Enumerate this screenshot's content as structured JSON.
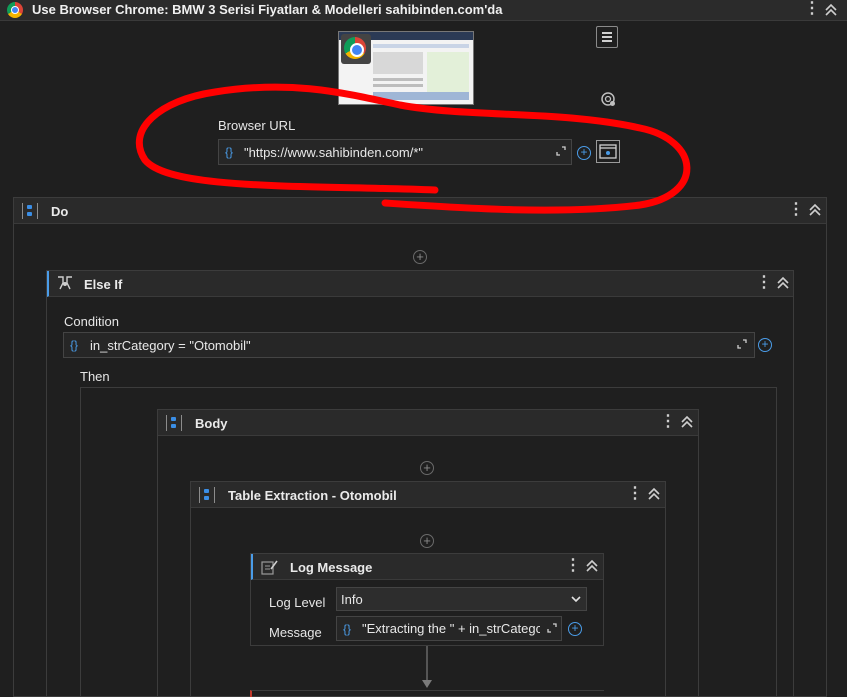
{
  "window": {
    "title": "Use Browser Chrome: BMW 3 Serisi Fiyatları & Modelleri sahibinden.com'da"
  },
  "browser_url": {
    "label": "Browser URL",
    "value": "\"https://www.sahibinden.com/*\""
  },
  "do": {
    "title": "Do"
  },
  "else_if": {
    "title": "Else If",
    "condition_label": "Condition",
    "condition_value": "in_strCategory = \"Otomobil\"",
    "then_label": "Then"
  },
  "body": {
    "title": "Body"
  },
  "table_extraction": {
    "title": "Table Extraction - Otomobil"
  },
  "log_message": {
    "title": "Log Message",
    "level_label": "Log Level",
    "level_value": "Info",
    "message_label": "Message",
    "message_value": "\"Extracting the \" + in_strCategc"
  },
  "icons": {
    "brace": "{}",
    "kebab": "⋮",
    "collapse": "⌃⌃",
    "plus": "+"
  },
  "colors": {
    "accent": "#4a9ce8",
    "annotation": "#ff0000",
    "background": "#1f1f1f"
  }
}
